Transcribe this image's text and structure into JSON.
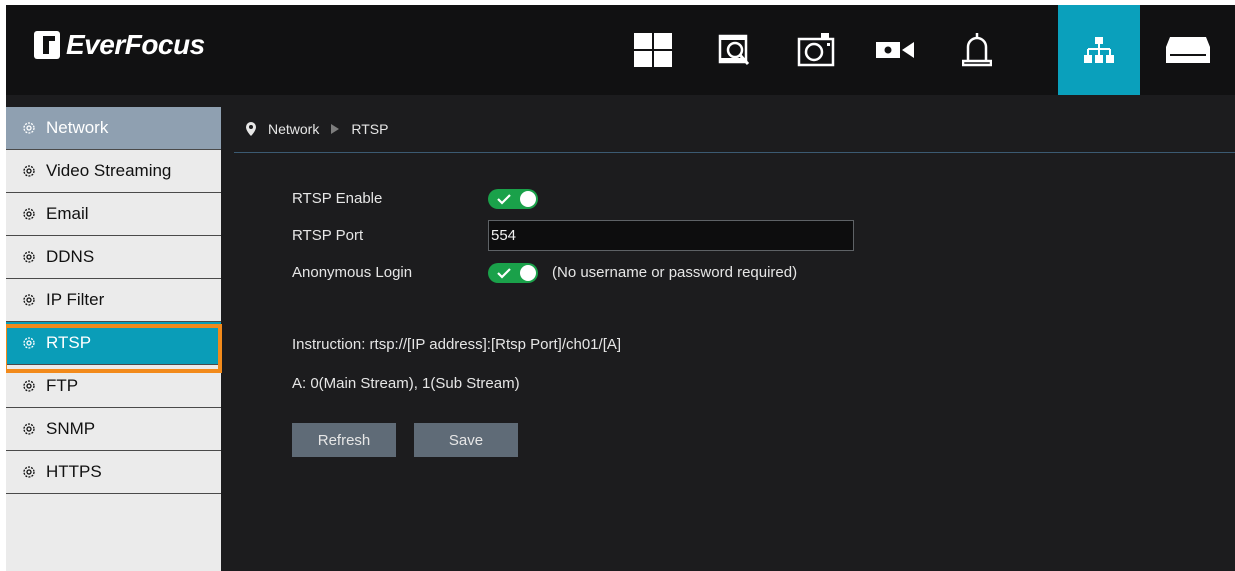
{
  "app": {
    "logo_text": "EverFocus"
  },
  "header": {
    "icons": [
      "live-view-icon",
      "playback-icon",
      "snapshot-icon",
      "camera-icon",
      "alarm-icon",
      "network-icon",
      "storage-icon"
    ],
    "active_icon": "network-icon",
    "accent_color": "#0aa0bc"
  },
  "sidebar": {
    "items": [
      {
        "label": "Network"
      },
      {
        "label": "Video Streaming"
      },
      {
        "label": "Email"
      },
      {
        "label": "DDNS"
      },
      {
        "label": "IP Filter"
      },
      {
        "label": "RTSP"
      },
      {
        "label": "FTP"
      },
      {
        "label": "SNMP"
      },
      {
        "label": "HTTPS"
      }
    ],
    "active_item": "RTSP",
    "highlight_color": "#f28a1b"
  },
  "breadcrumb": {
    "parent": "Network",
    "current": "RTSP"
  },
  "form": {
    "rtsp_enable_label": "RTSP Enable",
    "rtsp_enable": true,
    "rtsp_port_label": "RTSP Port",
    "rtsp_port_value": "554",
    "anonymous_login_label": "Anonymous Login",
    "anonymous_login": true,
    "anonymous_login_note": "(No username or password required)",
    "toggle_color": "#1aa14a"
  },
  "instructions": {
    "line1": "Instruction: rtsp://[IP address]:[Rtsp Port]/ch01/[A]",
    "line2": "A: 0(Main Stream), 1(Sub Stream)"
  },
  "buttons": {
    "refresh_label": "Refresh",
    "save_label": "Save"
  }
}
